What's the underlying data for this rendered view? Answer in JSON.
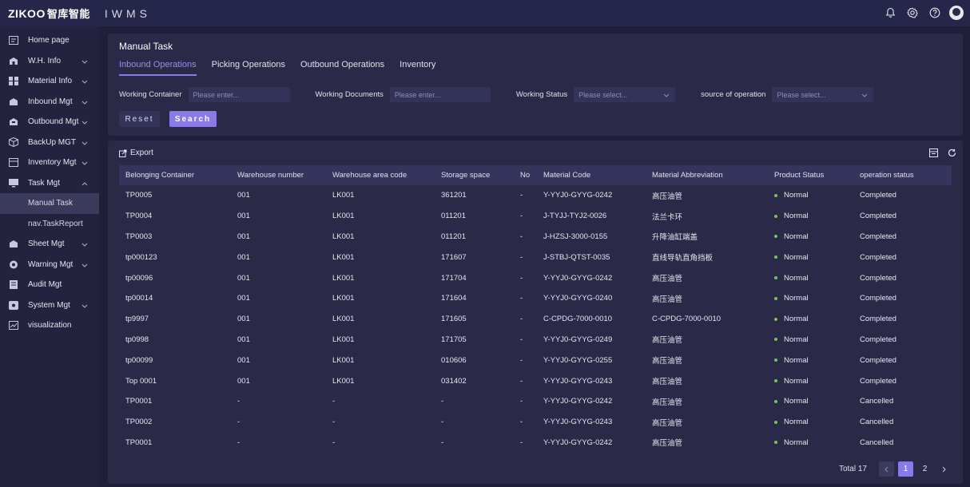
{
  "header": {
    "brand": "ZIKOO",
    "brand_cn": "智库智能",
    "product": "IWMS",
    "icons": [
      "bell-icon",
      "gear-icon",
      "help-icon",
      "avatar"
    ]
  },
  "sidebar": {
    "items": [
      {
        "label": "Home page",
        "icon": "home-icon",
        "chevron": false
      },
      {
        "label": "W.H. Info",
        "icon": "warehouse-icon",
        "chevron": true
      },
      {
        "label": "Material Info",
        "icon": "grid-icon",
        "chevron": true
      },
      {
        "label": "Inbound Mgt",
        "icon": "inbound-icon",
        "chevron": true
      },
      {
        "label": "Outbound Mgt",
        "icon": "outbound-icon",
        "chevron": true
      },
      {
        "label": "BackUp MGT",
        "icon": "box-icon",
        "chevron": true
      },
      {
        "label": "Inventory Mgt",
        "icon": "inventory-icon",
        "chevron": true
      },
      {
        "label": "Task Mgt",
        "icon": "monitor-icon",
        "chevron": true,
        "expanded": true
      },
      {
        "label": "Manual Task",
        "sub": true,
        "active": true
      },
      {
        "label": "nav.TaskReport",
        "sub": true
      },
      {
        "label": "Sheet Mgt",
        "icon": "sheet-icon",
        "chevron": true
      },
      {
        "label": "Warning Mgt",
        "icon": "warning-icon",
        "chevron": true
      },
      {
        "label": "Audit Mgt",
        "icon": "audit-icon",
        "chevron": false
      },
      {
        "label": "System Mgt",
        "icon": "system-icon",
        "chevron": true
      },
      {
        "label": "visualization",
        "icon": "chart-icon",
        "chevron": false
      }
    ]
  },
  "main": {
    "title": "Manual Task",
    "tabs": [
      "Inbound Operations",
      "Picking Operations",
      "Outbound Operations",
      "Inventory"
    ],
    "active_tab": 0,
    "filters": {
      "working_container": {
        "label": "Working Container",
        "placeholder": "Please enter..."
      },
      "working_documents": {
        "label": "Working Documents",
        "placeholder": "Please enter..."
      },
      "working_status": {
        "label": "Working Status",
        "placeholder": "Please select..."
      },
      "source_of_operation": {
        "label": "source of operation",
        "placeholder": "Please select..."
      }
    },
    "reset_label": "Reset",
    "search_label": "Search",
    "export_label": "Export",
    "table": {
      "columns": [
        "Belonging Container",
        "Warehouse number",
        "Warehouse area code",
        "Storage space",
        "No",
        "Material Code",
        "Material Abbreviation",
        "Product Status",
        "operation status"
      ],
      "rows": [
        [
          "TP0005",
          "001",
          "LK001",
          "361201",
          "-",
          "Y-YYJ0-GYYG-0242",
          "高压油管",
          "Normal",
          "Completed"
        ],
        [
          "TP0004",
          "001",
          "LK001",
          "011201",
          "-",
          "J-TYJJ-TYJ2-0026",
          "法兰卡环",
          "Normal",
          "Completed"
        ],
        [
          "TP0003",
          "001",
          "LK001",
          "011201",
          "-",
          "J-HZSJ-3000-0155",
          "升降油缸端盖",
          "Normal",
          "Completed"
        ],
        [
          "tp000123",
          "001",
          "LK001",
          "171607",
          "-",
          "J-STBJ-QTST-0035",
          "直线导轨直角挡板",
          "Normal",
          "Completed"
        ],
        [
          "tp00096",
          "001",
          "LK001",
          "171704",
          "-",
          "Y-YYJ0-GYYG-0242",
          "高压油管",
          "Normal",
          "Completed"
        ],
        [
          "tp00014",
          "001",
          "LK001",
          "171604",
          "-",
          "Y-YYJ0-GYYG-0240",
          "高压油管",
          "Normal",
          "Completed"
        ],
        [
          "tp9997",
          "001",
          "LK001",
          "171605",
          "-",
          "C-CPDG-7000-0010",
          "C-CPDG-7000-0010",
          "Normal",
          "Completed"
        ],
        [
          "tp0998",
          "001",
          "LK001",
          "171705",
          "-",
          "Y-YYJ0-GYYG-0249",
          "高压油管",
          "Normal",
          "Completed"
        ],
        [
          "tp00099",
          "001",
          "LK001",
          "010606",
          "-",
          "Y-YYJ0-GYYG-0255",
          "高压油管",
          "Normal",
          "Completed"
        ],
        [
          "Top 0001",
          "001",
          "LK001",
          "031402",
          "-",
          "Y-YYJ0-GYYG-0243",
          "高压油管",
          "Normal",
          "Completed"
        ],
        [
          "TP0001",
          "-",
          "-",
          "-",
          "-",
          "Y-YYJ0-GYYG-0242",
          "高压油管",
          "Normal",
          "Cancelled"
        ],
        [
          "TP0002",
          "-",
          "-",
          "-",
          "-",
          "Y-YYJ0-GYYG-0243",
          "高压油管",
          "Normal",
          "Cancelled"
        ],
        [
          "TP0001",
          "-",
          "-",
          "-",
          "-",
          "Y-YYJ0-GYYG-0242",
          "高压油管",
          "Normal",
          "Cancelled"
        ]
      ]
    },
    "pagination": {
      "total_label": "Total 17",
      "pages": [
        "1",
        "2"
      ],
      "current": "1"
    }
  },
  "colors": {
    "accent": "#8a7ae6",
    "status_normal": "#7cc25c",
    "background": "#1f1f3a",
    "panel": "#2a2a48"
  }
}
